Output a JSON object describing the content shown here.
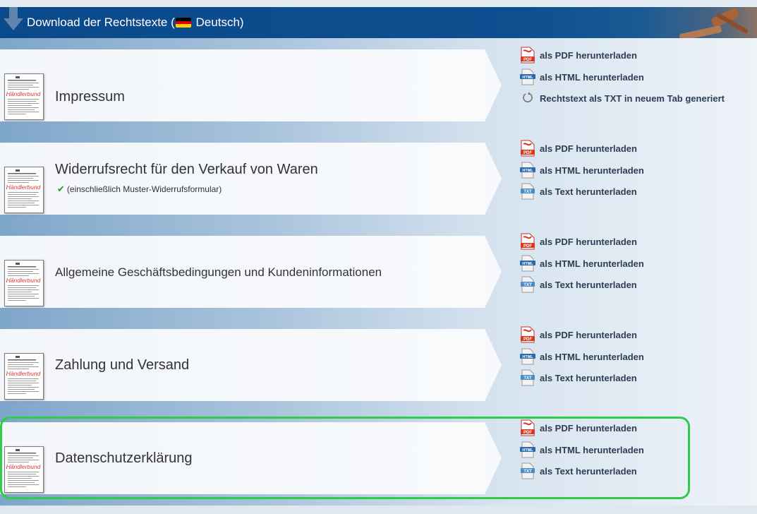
{
  "header": {
    "title": "Download der Rechtstexte",
    "paren_open": "(",
    "language": "Deutsch",
    "paren_close": ")"
  },
  "documents": [
    {
      "title": "Impressum",
      "subtitle": "",
      "links": [
        {
          "label": "als PDF herunterladen",
          "icon": "pdf-icon"
        },
        {
          "label": "als HTML herunterladen",
          "icon": "html-icon"
        },
        {
          "label": "Rechtstext als TXT in neuem Tab generiert",
          "icon": "loading-icon"
        }
      ]
    },
    {
      "title": "Widerrufsrecht für den Verkauf von Waren",
      "subtitle": "(einschließlich Muster-Widerrufsformular)",
      "links": [
        {
          "label": "als PDF herunterladen",
          "icon": "pdf-icon"
        },
        {
          "label": "als HTML herunterladen",
          "icon": "html-icon"
        },
        {
          "label": "als Text herunterladen",
          "icon": "txt-icon"
        }
      ]
    },
    {
      "title": "Allgemeine Geschäftsbedingungen und Kundeninformationen",
      "subtitle": "",
      "links": [
        {
          "label": "als PDF herunterladen",
          "icon": "pdf-icon"
        },
        {
          "label": "als HTML herunterladen",
          "icon": "html-icon"
        },
        {
          "label": "als Text herunterladen",
          "icon": "txt-icon"
        }
      ]
    },
    {
      "title": "Zahlung und Versand",
      "subtitle": "",
      "links": [
        {
          "label": "als PDF herunterladen",
          "icon": "pdf-icon"
        },
        {
          "label": "als HTML herunterladen",
          "icon": "html-icon"
        },
        {
          "label": "als Text herunterladen",
          "icon": "txt-icon"
        }
      ]
    },
    {
      "title": "Datenschutzerklärung",
      "subtitle": "",
      "links": [
        {
          "label": "als PDF herunterladen",
          "icon": "pdf-icon"
        },
        {
          "label": "als HTML herunterladen",
          "icon": "html-icon"
        },
        {
          "label": "als Text herunterladen",
          "icon": "txt-icon"
        }
      ]
    }
  ],
  "thumbnail_stamp": "Händlerbund",
  "colors": {
    "header_bg": "#0e4f90",
    "highlight": "#2ecc48",
    "pdf_red": "#d9381e",
    "html_blue": "#2b6cb0",
    "check_green": "#2a9a2a"
  }
}
